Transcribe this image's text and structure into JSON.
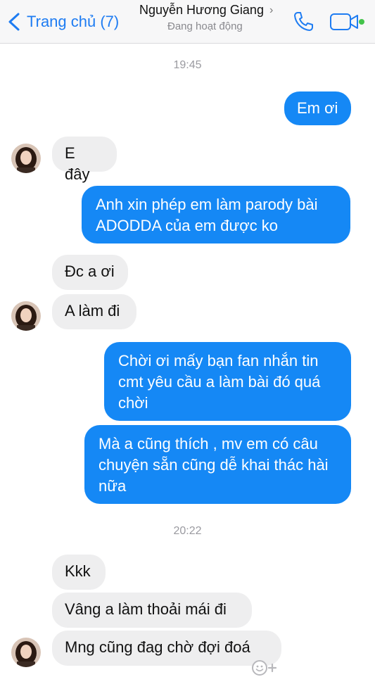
{
  "header": {
    "back_label": "Trang chủ (7)",
    "contact_name": "Nguyễn Hương Giang",
    "contact_status": "Đang hoạt động",
    "icons": {
      "back": "chevron-left-icon",
      "call": "phone-icon",
      "video": "video-camera-icon",
      "online": "online-dot-icon"
    }
  },
  "colors": {
    "accent": "#1588f5",
    "incoming_bubble": "#eeeeef",
    "online": "#44c34b"
  },
  "messages": {
    "time_1": "19:45",
    "m1": "Em ơi",
    "m2": "E đây",
    "m3": "Anh xin phép em làm parody bài ADODDA của em được ko",
    "m4": "Đc a ơi",
    "m5": "A làm đi",
    "m6": "Chời ơi mấy bạn fan nhắn tin cmt yêu cầu a làm bài đó quá chời",
    "m7": "Mà a cũng thích , mv em có câu chuyện sẵn cũng dễ khai thác hài nữa",
    "time_2": "20:22",
    "m8": "Kkk",
    "m9": "Vâng a làm thoải mái đi",
    "m10": "Mng cũng đag chờ đợi đoá"
  }
}
